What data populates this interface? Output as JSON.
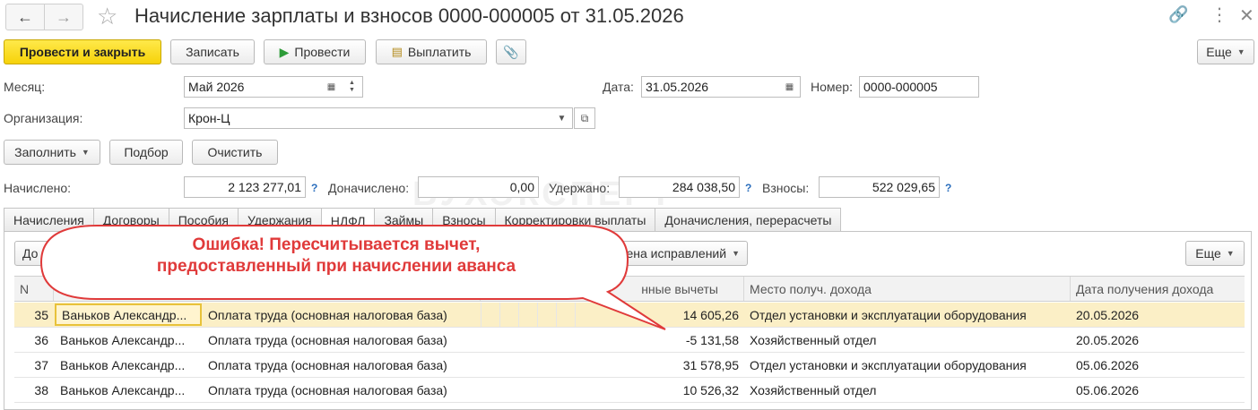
{
  "window": {
    "title": "Начисление зарплаты и взносов 0000-000005 от 31.05.2026"
  },
  "toolbar": {
    "post_close": "Провести и закрыть",
    "save": "Записать",
    "post": "Провести",
    "pay": "Выплатить",
    "more": "Еще"
  },
  "form": {
    "month_label": "Месяц:",
    "month_value": "Май 2026",
    "date_label": "Дата:",
    "date_value": "31.05.2026",
    "number_label": "Номер:",
    "number_value": "0000-000005",
    "org_label": "Организация:",
    "org_value": "Крон-Ц"
  },
  "actions": {
    "fill": "Заполнить",
    "pick": "Подбор",
    "clear": "Очистить"
  },
  "totals": {
    "accrued_label": "Начислено:",
    "accrued_value": "2 123 277,01",
    "extra_label": "Доначислено:",
    "extra_value": "0,00",
    "withheld_label": "Удержано:",
    "withheld_value": "284 038,50",
    "contrib_label": "Взносы:",
    "contrib_value": "522 029,65",
    "help": "?"
  },
  "tabs": [
    "Начисления",
    "Договоры",
    "Пособия",
    "Удержания",
    "НДФЛ",
    "Займы",
    "Взносы",
    "Корректировки выплаты",
    "Доначисления, перерасчеты"
  ],
  "panel": {
    "left_btn_fragment": "До",
    "corrections_btn": "ена исправлений",
    "more": "Еще"
  },
  "callout": {
    "line1": "Ошибка! Пересчитывается вычет,",
    "line2": "предоставленный при начислении аванса"
  },
  "watermark": "БУХЭКСПЕРТ",
  "table": {
    "headers": {
      "n": "N",
      "deductions": "нные вычеты",
      "place": "Место получ. дохода",
      "date": "Дата получения дохода"
    },
    "rows": [
      {
        "n": "35",
        "employee": "Ваньков Александр...",
        "type": "Оплата труда (основная налоговая база)",
        "deduction": "14 605,26",
        "place": "Отдел установки и эксплуатации оборудования",
        "date": "20.05.2026"
      },
      {
        "n": "36",
        "employee": "Ваньков Александр...",
        "type": "Оплата труда (основная налоговая база)",
        "deduction": "-5 131,58",
        "place": "Хозяйственный отдел",
        "date": "20.05.2026"
      },
      {
        "n": "37",
        "employee": "Ваньков Александр...",
        "type": "Оплата труда (основная налоговая база)",
        "deduction": "31 578,95",
        "place": "Отдел установки и эксплуатации оборудования",
        "date": "05.06.2026"
      },
      {
        "n": "38",
        "employee": "Ваньков Александр...",
        "type": "Оплата труда (основная налоговая база)",
        "deduction": "10 526,32",
        "place": "Хозяйственный отдел",
        "date": "05.06.2026"
      }
    ]
  }
}
